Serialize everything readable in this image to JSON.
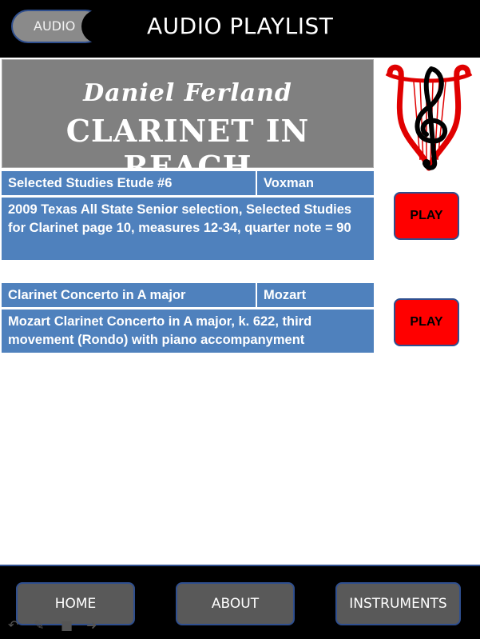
{
  "header": {
    "audio_tab_label": "AUDIO",
    "title": "AUDIO PLAYLIST"
  },
  "banner": {
    "author": "Daniel Ferland",
    "brand": "CLARINET IN REACH"
  },
  "tracks": [
    {
      "title": "Selected Studies Etude #6",
      "composer": "Voxman",
      "description": "2009 Texas All State Senior selection, Selected Studies for Clarinet page 10, measures 12-34, quarter note = 90",
      "play_label": "PLAY"
    },
    {
      "title": "Clarinet Concerto in A major",
      "composer": "Mozart",
      "description": "Mozart Clarinet Concerto in A major, k. 622, third movement (Rondo) with piano accompanyment",
      "play_label": "PLAY"
    }
  ],
  "footer": {
    "home_label": "HOME",
    "about_label": "ABOUT",
    "instruments_label": "INSTRUMENTS"
  },
  "colors": {
    "cell_blue": "#4f81bd",
    "play_red": "#ff0000",
    "nav_gray": "#595959",
    "border_blue": "#2f4f8f"
  }
}
